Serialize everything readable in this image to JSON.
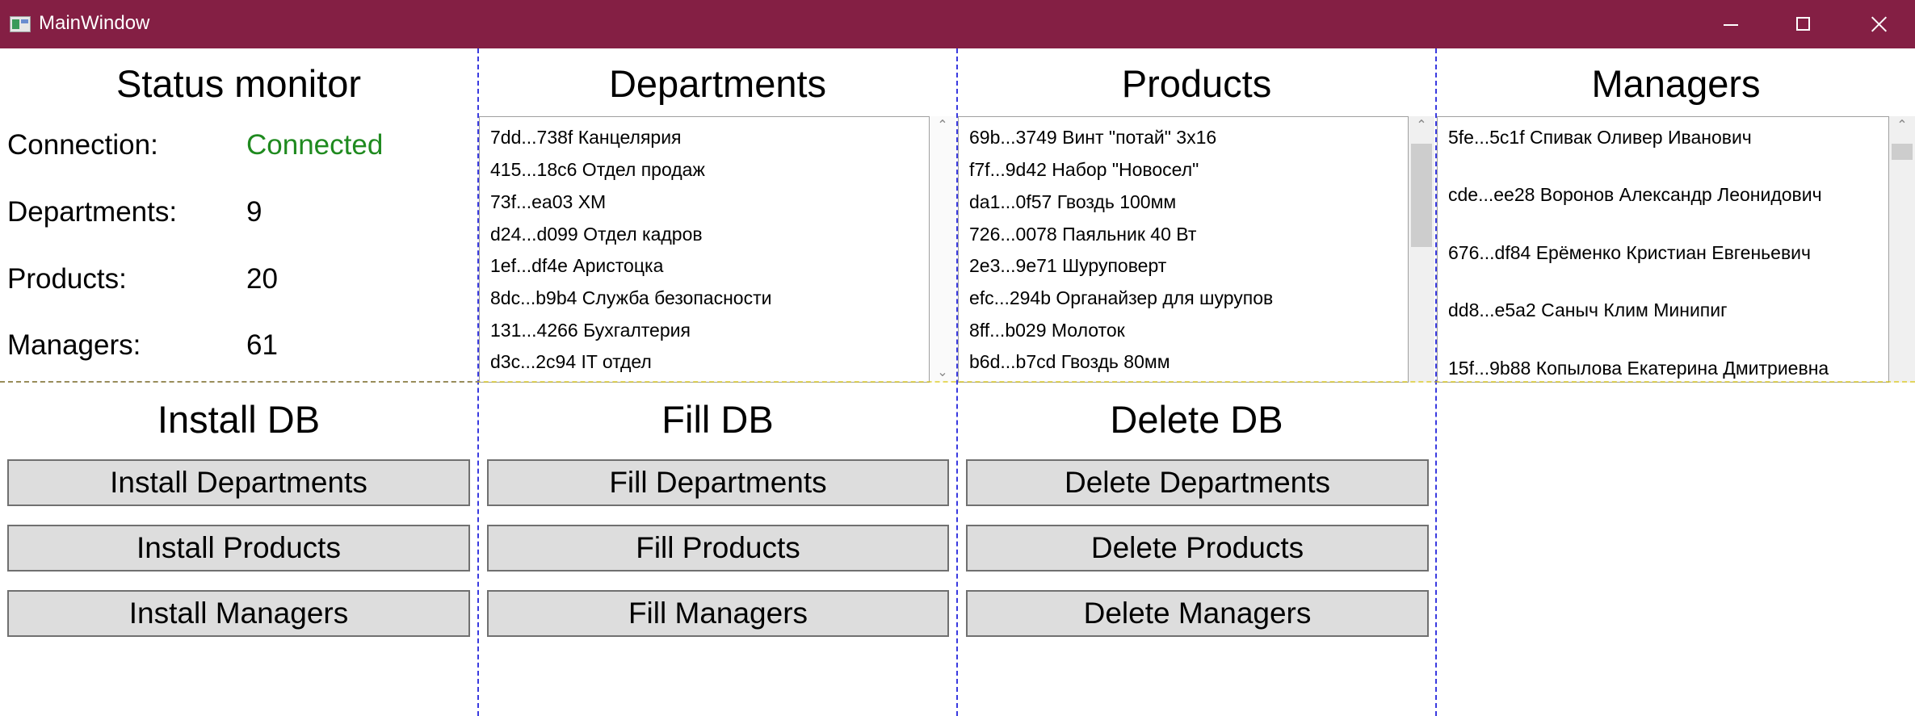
{
  "window": {
    "title": "MainWindow"
  },
  "status": {
    "heading": "Status monitor",
    "connection_label": "Connection:",
    "connection_value": "Connected",
    "departments_label": "Departments:",
    "departments_value": "9",
    "products_label": "Products:",
    "products_value": "20",
    "managers_label": "Managers:",
    "managers_value": "61",
    "connected_color": "#1f8a1f"
  },
  "departments": {
    "heading": "Departments",
    "items": [
      "7dd...738f Канцелярия",
      "415...18c6 Отдел продаж",
      "73f...ea03 ХМ",
      "d24...d099 Отдел кадров",
      "1ef...df4e Аристоцка",
      "8dc...b9b4 Служба безопасности",
      "131...4266 Бухгалтерия",
      "d3c...2c94 IT отдел"
    ]
  },
  "products": {
    "heading": "Products",
    "items": [
      "69b...3749 Винт \"потай\" 3х16",
      "f7f...9d42 Набор \"Новосел\"",
      "da1...0f57 Гвоздь 100мм",
      "726...0078 Паяльник 40 Вт",
      "2e3...9e71 Шуруповерт",
      "efc...294b Органайзер для шурупов",
      "8ff...b029 Молоток",
      "b6d...b7cd Гвоздь 80мм"
    ]
  },
  "managers": {
    "heading": "Managers",
    "items": [
      "5fe...5c1f Спивак Оливер Иванович",
      "cde...ee28 Воронов Александр Леонидович",
      "676...df84 Ерёменко Кристиан Евгеньевич",
      "dd8...e5a2 Саныч Клим Минипиг",
      "15f...9b88 Копылова Екатерина Дмитриевна"
    ]
  },
  "install": {
    "heading": "Install DB",
    "departments_label": "Install Departments",
    "products_label": "Install Products",
    "managers_label": "Install Managers"
  },
  "fill": {
    "heading": "Fill DB",
    "departments_label": "Fill Departments",
    "products_label": "Fill Products",
    "managers_label": "Fill Managers"
  },
  "delete": {
    "heading": "Delete DB",
    "departments_label": "Delete Departments",
    "products_label": "Delete Products",
    "managers_label": "Delete Managers"
  },
  "colors": {
    "titlebar": "#841f44",
    "button_bg": "#dddddd",
    "grid_lines": "#3a3ae0"
  }
}
